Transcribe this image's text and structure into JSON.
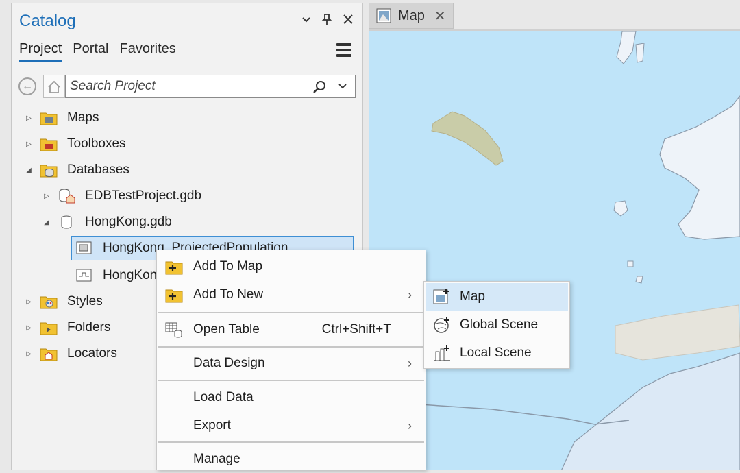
{
  "catalog": {
    "title": "Catalog",
    "tabs": [
      {
        "label": "Project",
        "active": true
      },
      {
        "label": "Portal",
        "active": false
      },
      {
        "label": "Favorites",
        "active": false
      }
    ],
    "search_placeholder": "Search Project",
    "tree": [
      {
        "label": "Maps",
        "icon": "folder-maps-icon",
        "expanded": false
      },
      {
        "label": "Toolboxes",
        "icon": "folder-toolbox-icon",
        "expanded": false
      },
      {
        "label": "Databases",
        "icon": "folder-database-icon",
        "expanded": true
      },
      {
        "label": "EDBTestProject.gdb",
        "icon": "enterprise-geodatabase-icon",
        "expanded": false
      },
      {
        "label": "HongKong.gdb",
        "icon": "geodatabase-icon",
        "expanded": true
      },
      {
        "label": "HongKong_ProjectedPopulation",
        "icon": "polygon-featureclass-icon"
      },
      {
        "label": "HongKong_Boundaries",
        "icon": "line-featureclass-icon"
      },
      {
        "label": "Styles",
        "icon": "folder-styles-icon",
        "expanded": false
      },
      {
        "label": "Folders",
        "icon": "folder-icon",
        "expanded": false
      },
      {
        "label": "Locators",
        "icon": "folder-locators-icon",
        "expanded": false
      }
    ]
  },
  "map_tab": {
    "label": "Map"
  },
  "context_menu": {
    "items": [
      {
        "label": "Add To Map",
        "icon": "add-to-map-icon"
      },
      {
        "label": "Add To New",
        "icon": "add-to-new-icon",
        "submenu": true
      },
      {
        "label": "Open Table",
        "icon": "table-icon",
        "shortcut": "Ctrl+Shift+T"
      },
      {
        "label": "Data Design",
        "submenu": true
      },
      {
        "label": "Load Data"
      },
      {
        "label": "Export",
        "submenu": true
      },
      {
        "label": "Manage"
      }
    ]
  },
  "submenu": {
    "items": [
      {
        "label": "Map",
        "icon": "new-map-icon",
        "highlighted": true
      },
      {
        "label": "Global Scene",
        "icon": "global-scene-icon"
      },
      {
        "label": "Local Scene",
        "icon": "local-scene-icon"
      }
    ]
  },
  "colors": {
    "accent": "#1e6fb8",
    "water": "#bfe4f9",
    "land": "#eef3f9",
    "selection": "#cfe4f7"
  }
}
